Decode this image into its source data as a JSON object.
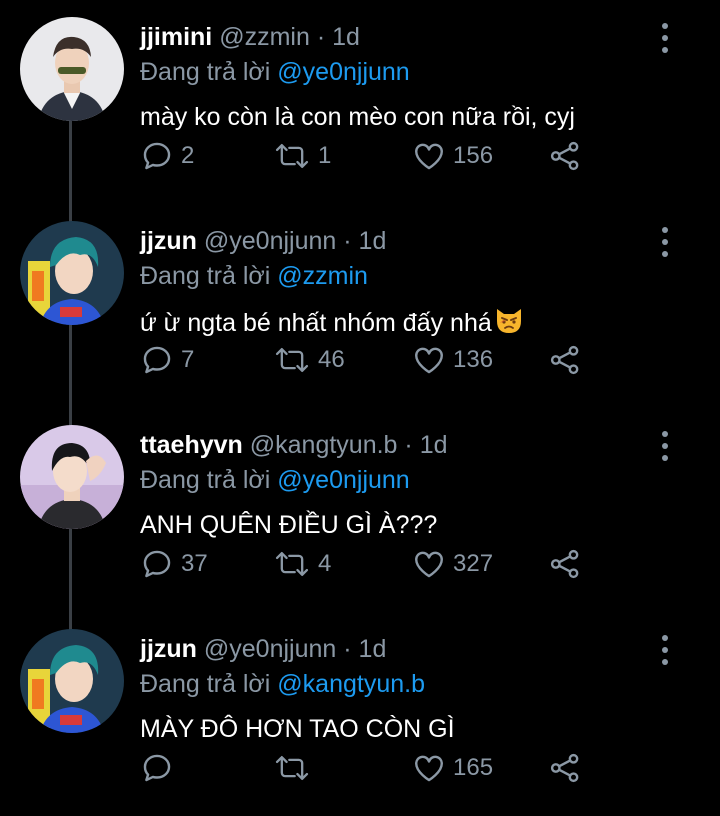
{
  "tweets": [
    {
      "name": "jjimini",
      "handle": "@zzmin",
      "sep": "·",
      "time": "1d",
      "reply_prefix": "Đang trả lời",
      "reply_to": "@ye0njjunn",
      "text": "mày ko còn là con mèo con nữa rồi, cyj",
      "replies": "2",
      "retweets": "1",
      "likes": "156"
    },
    {
      "name": "jjzun",
      "handle": "@ye0njjunn",
      "sep": "·",
      "time": "1d",
      "reply_prefix": "Đang trả lời",
      "reply_to": "@zzmin",
      "text": "ứ ừ ngta bé nhất nhóm đấy nhá",
      "emoji": "pouting-cat",
      "replies": "7",
      "retweets": "46",
      "likes": "136"
    },
    {
      "name": "ttaehyvn",
      "handle": "@kangtyun.b",
      "sep": "·",
      "time": "1d",
      "reply_prefix": "Đang trả lời",
      "reply_to": "@ye0njjunn",
      "text": "ANH QUÊN ĐIỀU GÌ À???",
      "replies": "37",
      "retweets": "4",
      "likes": "327"
    },
    {
      "name": "jjzun",
      "handle": "@ye0njjunn",
      "sep": "·",
      "time": "1d",
      "reply_prefix": "Đang trả lời",
      "reply_to": "@kangtyun.b",
      "text": "MÀY ĐÔ HƠN TAO CÒN GÌ",
      "replies": "",
      "retweets": "",
      "likes": "165"
    }
  ],
  "colors": {
    "background": "#000000",
    "text": "#ffffff",
    "secondary": "#8b98a5",
    "accent": "#1d9bf0",
    "thread_line": "#3a3f45"
  },
  "icons": [
    "reply-icon",
    "retweet-icon",
    "like-icon",
    "share-icon",
    "more-icon"
  ]
}
